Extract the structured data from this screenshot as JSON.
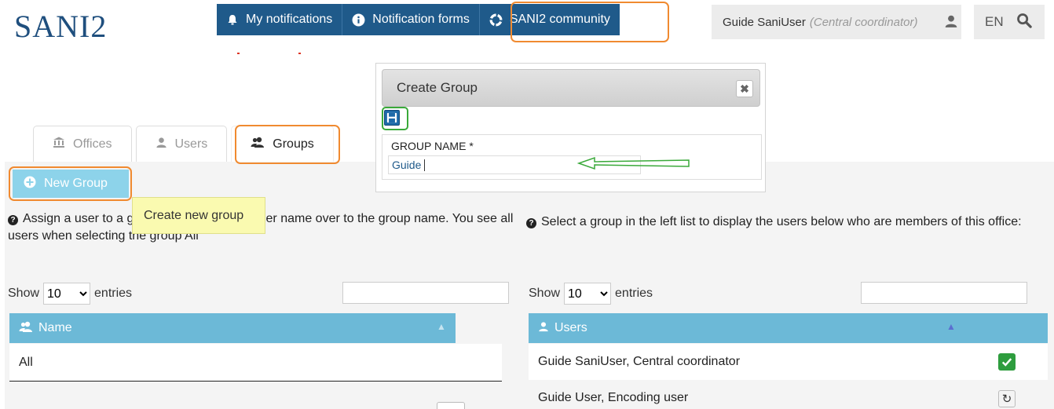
{
  "app": {
    "logo": "SANI2"
  },
  "topnav": {
    "items": [
      {
        "label": "My notifications",
        "icon": "notification-bell-icon"
      },
      {
        "label": "Notification forms",
        "icon": "info-icon"
      },
      {
        "label": "SANI2 community",
        "icon": "life-ring-icon"
      }
    ]
  },
  "user": {
    "name": "Guide SaniUser",
    "role": "(Central coordinator)"
  },
  "lang": {
    "label": "EN"
  },
  "tabs": [
    {
      "label": "Offices",
      "icon": "bank-icon"
    },
    {
      "label": "Users",
      "icon": "user-icon"
    },
    {
      "label": "Groups",
      "icon": "users-icon"
    }
  ],
  "actions": {
    "new_group": "New Group",
    "tooltip": "Create new group"
  },
  "help": {
    "left": "Assign a user to a group by dragging the user name over to the group name. You see all users when selecting the group All",
    "right": "Select a group in the left list to display the users below who are members of this office:"
  },
  "left_table": {
    "show_label": "Show",
    "entries_label": "entries",
    "page_size": "10",
    "header": "Name",
    "rows": [
      "All"
    ]
  },
  "right_table": {
    "show_label": "Show",
    "entries_label": "entries",
    "page_size": "10",
    "header": "Users",
    "rows": [
      {
        "name": "Guide SaniUser, Central coordinator",
        "action": "check-icon"
      },
      {
        "name": "Guide User, Encoding user",
        "action": "refresh-icon"
      }
    ]
  },
  "dialog": {
    "title": "Create Group",
    "field_label": "GROUP NAME *",
    "field_value": "Guide"
  },
  "colors": {
    "nav": "#1f5a8a",
    "table_header": "#6cb9d7",
    "highlight": "#f08a30",
    "save_highlight": "#3aa93a",
    "tooltip": "#fafab0"
  }
}
